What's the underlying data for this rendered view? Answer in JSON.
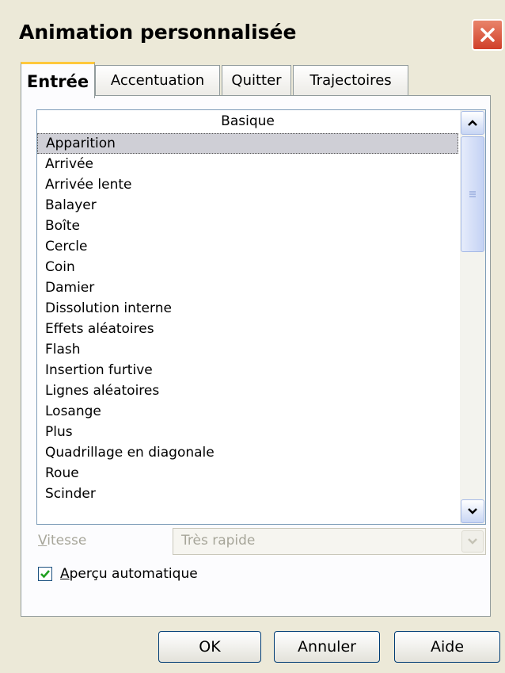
{
  "window": {
    "title": "Animation personnalisée",
    "close_icon": "close-icon"
  },
  "tabs": [
    {
      "label": "Entrée",
      "active": true
    },
    {
      "label": "Accentuation",
      "active": false
    },
    {
      "label": "Quitter",
      "active": false
    },
    {
      "label": "Trajectoires",
      "active": false
    }
  ],
  "effects_list": {
    "header": "Basique",
    "items": [
      "Apparition",
      "Arrivée",
      "Arrivée lente",
      "Balayer",
      "Boîte",
      "Cercle",
      "Coin",
      "Damier",
      "Dissolution interne",
      "Effets aléatoires",
      "Flash",
      "Insertion furtive",
      "Lignes aléatoires",
      "Losange",
      "Plus",
      "Quadrillage en diagonale",
      "Roue",
      "Scinder"
    ],
    "selected": "Apparition",
    "scroll_up_icon": "chevron-up-icon",
    "scroll_down_icon": "chevron-down-icon",
    "scroll_thumb_grip_icon": "grip-icon"
  },
  "speed": {
    "label_accel": "V",
    "label_rest": "itesse",
    "value": "Très rapide",
    "enabled": false,
    "dropdown_icon": "chevron-down-icon"
  },
  "auto_preview": {
    "label_accel": "A",
    "label_rest": "perçu automatique",
    "checked": true,
    "check_icon": "checkmark-icon"
  },
  "buttons": {
    "ok": "OK",
    "cancel": "Annuler",
    "help": "Aide"
  },
  "colors": {
    "dialog_bg": "#ece9d8",
    "active_tab_accent": "#ffc83c",
    "close_button": "#d9553a",
    "selection_bg": "#cfcfd6",
    "disabled_text": "#a7a69a",
    "checkmark": "#21a121"
  }
}
